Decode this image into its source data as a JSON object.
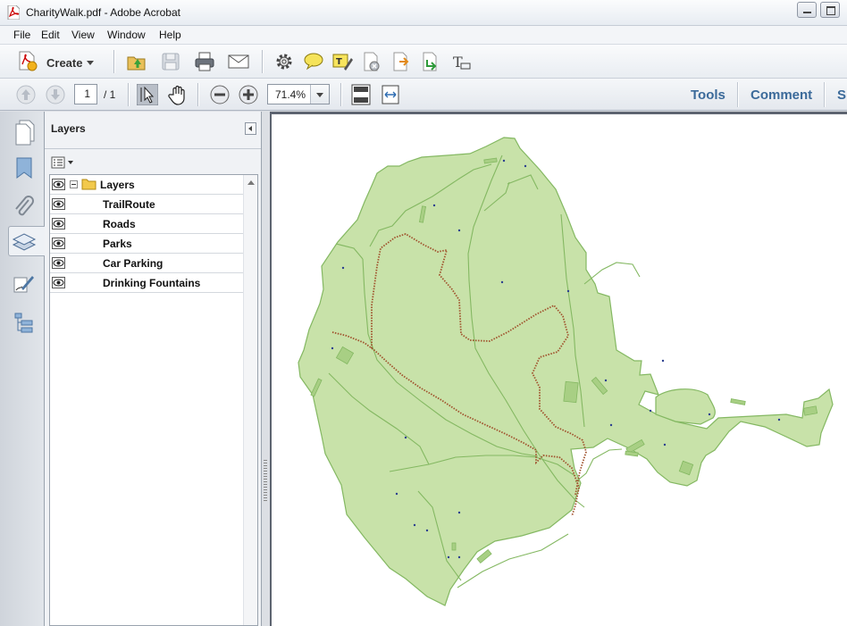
{
  "window": {
    "title": "CharityWalk.pdf - Adobe Acrobat",
    "minimize": "minimize",
    "maximize": "maximize"
  },
  "menu": [
    "File",
    "Edit",
    "View",
    "Window",
    "Help"
  ],
  "toolbar": {
    "create_label": "Create",
    "icons": [
      "open-icon",
      "save-icon",
      "print-icon",
      "email-icon",
      "settings-icon",
      "comment-icon",
      "highlight-icon",
      "delete-page-icon",
      "export-icon",
      "extract-icon",
      "typewriter-icon"
    ]
  },
  "navigation": {
    "current_page": "1",
    "total_pages": "/ 1",
    "zoom": "71.4%",
    "panel_links": [
      "Tools",
      "Comment",
      "Sh"
    ]
  },
  "layers_panel": {
    "title": "Layers",
    "root": "Layers",
    "items": [
      "TrailRoute",
      "Roads",
      "Parks",
      "Car Parking",
      "Drinking Fountains"
    ]
  },
  "map": {
    "park_fill": "#c8e2a9",
    "park_stroke": "#84b862",
    "trail_color": "#a0522d",
    "fountain_color": "#2b3f8f"
  }
}
